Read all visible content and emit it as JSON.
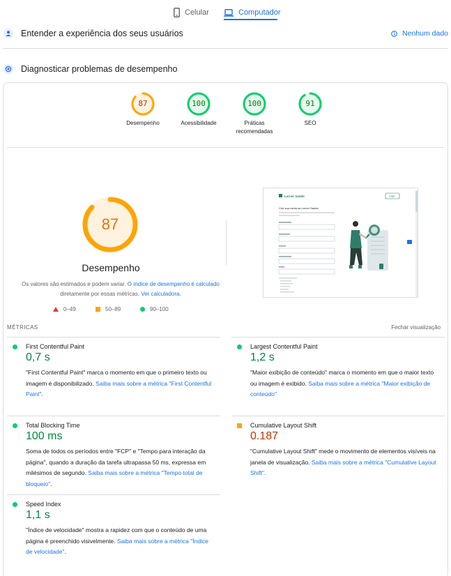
{
  "tabs": {
    "mobile": "Celular",
    "desktop": "Computador"
  },
  "sections": {
    "experience_title": "Entender a experiência dos seus usuários",
    "no_data": "Nenhum dado",
    "diagnose_title": "Diagnosticar problemas de desempenho"
  },
  "scores": [
    {
      "value": "87",
      "label": "Desempenho",
      "color": "#ffa400",
      "text_color": "#c33300",
      "fraction": 0.87
    },
    {
      "value": "100",
      "label": "Acessibilidade",
      "color": "#0cce6b",
      "text_color": "#008800",
      "fraction": 1.0
    },
    {
      "value": "100",
      "label_line1": "Práticas",
      "label_line2": "recomendadas",
      "color": "#0cce6b",
      "text_color": "#008800",
      "fraction": 1.0
    },
    {
      "value": "91",
      "label": "SEO",
      "color": "#0cce6b",
      "text_color": "#008800",
      "fraction": 0.91
    }
  ],
  "main_score": {
    "value": "87",
    "title": "Desempenho",
    "fraction": 0.87
  },
  "note": {
    "text1": "Os valores são estimados e podem variar. O ",
    "link1": "índice de desempenho é calculado",
    "text2": " diretamente por essas métricas. ",
    "link2": "Ver calculadora."
  },
  "legend": {
    "bad": "0–49",
    "average": "50–89",
    "good": "90–100"
  },
  "thumbnail": {
    "brand": "Lerner Saúde",
    "button": "Login",
    "heading": "Crie sua conta na Lerner Saúde"
  },
  "metrics_header": "MÉTRICAS",
  "collapse": "Fechar visualização",
  "metrics": {
    "fcp": {
      "title": "First Contentful Paint",
      "value": "0,7 s",
      "desc": "\"First Contentful Paint\" marca o momento em que o primeiro texto ou imagem é disponibilizado. ",
      "link": "Saiba mais sobre a métrica \"First Contentful Paint\"",
      "end": "."
    },
    "lcp": {
      "title": "Largest Contentful Paint",
      "value": "1,2 s",
      "desc": "\"Maior exibição de conteúdo\" marca o momento em que o maior texto ou imagem é exibido. ",
      "link": "Saiba mais sobre a métrica \"Maior exibição de conteúdo\"",
      "end": ""
    },
    "tbt": {
      "title": "Total Blocking Time",
      "value": "100 ms",
      "desc": "Soma de todos os períodos entre \"FCP\" e \"Tempo para interação da página\", quando a duração da tarefa ultrapassa 50 ms, expressa em milésimos de segundo. ",
      "link": "Saiba mais sobre a métrica \"Tempo total de bloqueio\"",
      "end": "."
    },
    "cls": {
      "title": "Cumulative Layout Shift",
      "value": "0.187",
      "desc": "\"Cumulative Layout Shift\" mede o movimento de elementos visíveis na janela de visualização. ",
      "link": "Saiba mais sobre a métrica \"Cumulative Layout Shift\"",
      "end": "."
    },
    "si": {
      "title": "Speed Index",
      "value": "1,1 s",
      "desc": "\"Índice de velocidade\" mostra a rapidez com que o conteúdo de uma página é preenchido visivelmente. ",
      "link": "Saiba mais sobre a métrica \"Índice de velocidade\"",
      "end": "."
    }
  }
}
